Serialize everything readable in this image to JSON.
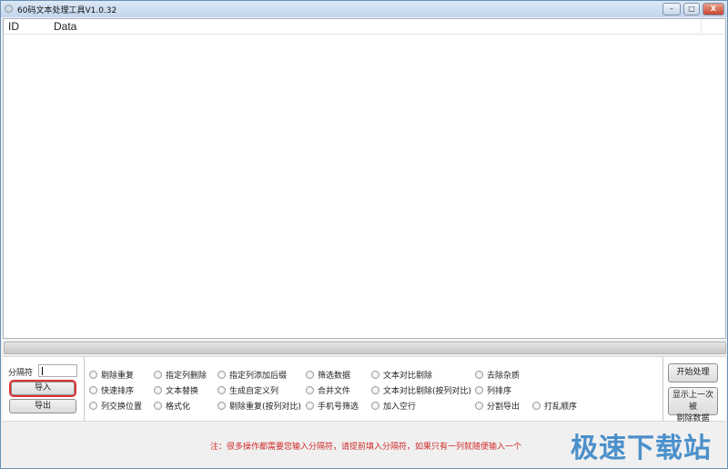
{
  "window": {
    "title": "60码文本处理工具V1.0.32",
    "minimize": "–",
    "maximize": "□",
    "close": "X"
  },
  "list": {
    "columns": [
      "ID",
      "Data"
    ],
    "rows": []
  },
  "progress": 0,
  "left": {
    "separator_label": "分隔符",
    "separator_value": "",
    "import_label": "导入",
    "export_label": "导出"
  },
  "options": [
    [
      "剔除重复",
      "指定列删除",
      "指定列添加后缀",
      "筛选数据",
      "文本对比剔除",
      "去除杂质"
    ],
    [
      "快速排序",
      "文本替换",
      "生成自定义列",
      "合并文件",
      "文本对比剔除(按列对比)",
      "列排序"
    ],
    [
      "列交换位置",
      "格式化",
      "剔除重复(按列对比)",
      "手机号筛选",
      "加入空行",
      "分割导出",
      "打乱顺序"
    ]
  ],
  "right": {
    "start_label": "开始处理",
    "show_removed_line1": "显示上一次被",
    "show_removed_line2": "剔除数据"
  },
  "note": "注：很多操作都需要您输入分隔符，请提前填入分隔符，如果只有一列就随便输入一个",
  "watermark": "极速下载站",
  "colors": {
    "note": "#d02a2a",
    "watermark": "#3a86c8",
    "focus": "#dd3333"
  }
}
